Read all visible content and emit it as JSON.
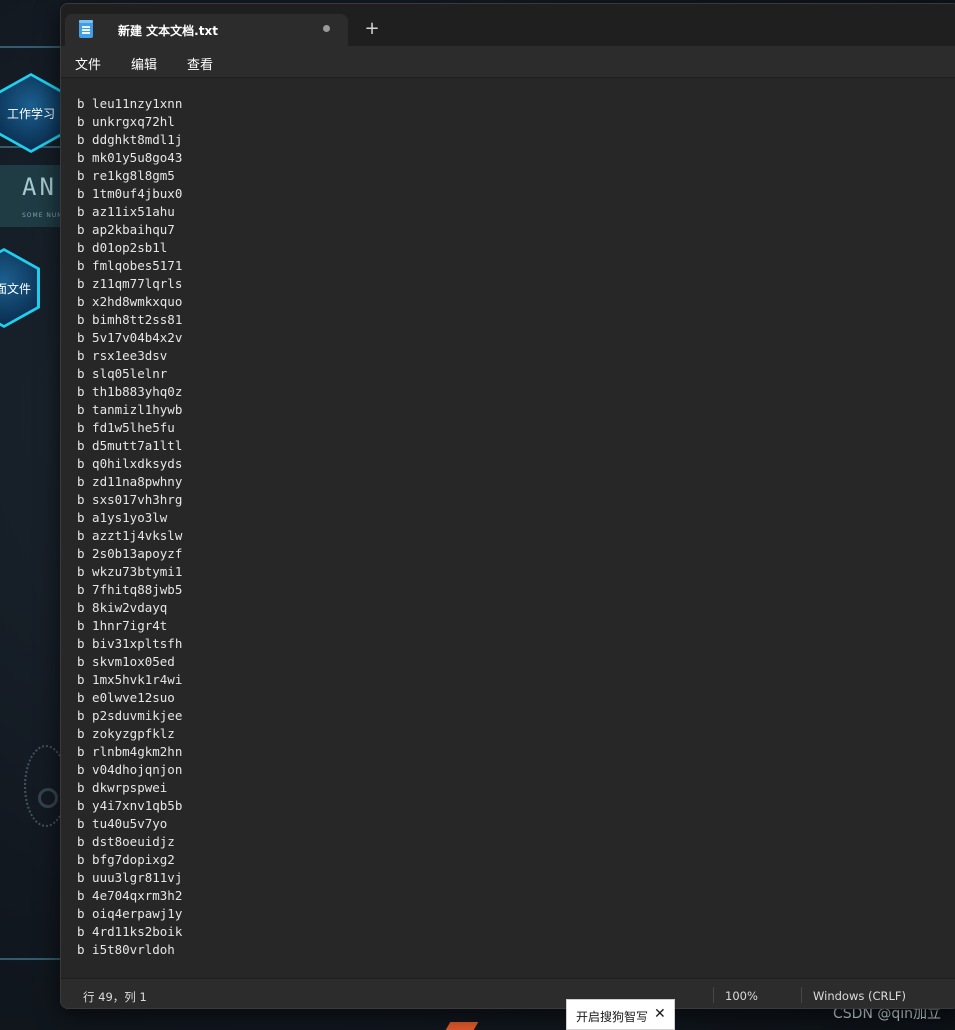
{
  "desktop": {
    "icons": [
      {
        "label": "工作学习"
      },
      {
        "label": "面文件"
      }
    ],
    "banner": {
      "title": "AN",
      "subtitle": "SOME NUM      ULT"
    },
    "watermark": "CSDN @qin加立"
  },
  "window": {
    "tab_title": "新建 文本文档.txt",
    "new_tab_label": "+",
    "menu": [
      "文件",
      "编辑",
      "查看"
    ],
    "lines": [
      "b leu11nzy1xnn",
      "b unkrgxq72hl",
      "b ddghkt8mdl1j",
      "b mk01y5u8go43",
      "b re1kg8l8gm5",
      "b 1tm0uf4jbux0",
      "b az11ix51ahu",
      "b ap2kbaihqu7",
      "b d01op2sb1l",
      "b fmlqobes5171",
      "b z11qm77lqrls",
      "b x2hd8wmkxquo",
      "b bimh8tt2ss81",
      "b 5v17v04b4x2v",
      "b rsx1ee3dsv",
      "b slq05lelnr",
      "b th1b883yhq0z",
      "b tanmizl1hywb",
      "b fd1w5lhe5fu",
      "b d5mutt7a1ltl",
      "b q0hilxdksyds",
      "b zd11na8pwhny",
      "b sxs017vh3hrg",
      "b a1ys1yo3lw",
      "b azzt1j4vkslw",
      "b 2s0b13apoyzf",
      "b wkzu73btymi1",
      "b 7fhitq88jwb5",
      "b 8kiw2vdayq",
      "b 1hnr7igr4t",
      "b biv31xpltsfh",
      "b skvm1ox05ed",
      "b 1mx5hvk1r4wi",
      "b e0lwve12suo",
      "b p2sduvmikjee",
      "b zokyzgpfklz",
      "b rlnbm4gkm2hn",
      "b v04dhojqnjon",
      "b dkwrpspwei",
      "b y4i7xnv1qb5b",
      "b tu40u5v7yo",
      "b dst8oeuidjz",
      "b bfg7dopixg2",
      "b uuu3lgr811vj",
      "b 4e704qxrm3h2",
      "b oiq4erpawj1y",
      "b 4rd11ks2boik",
      "b i5t80vrldoh"
    ],
    "status": {
      "position": "行 49，列 1",
      "zoom": "100%",
      "line_ending": "Windows (CRLF)"
    }
  },
  "ime_popup": {
    "label": "开启搜狗智写",
    "close": "✕"
  },
  "colors": {
    "window_bg": "#272727",
    "titlebar_bg": "#1f1f1f",
    "hex_border": "#20d0f0",
    "text": "#e6e6e6"
  }
}
